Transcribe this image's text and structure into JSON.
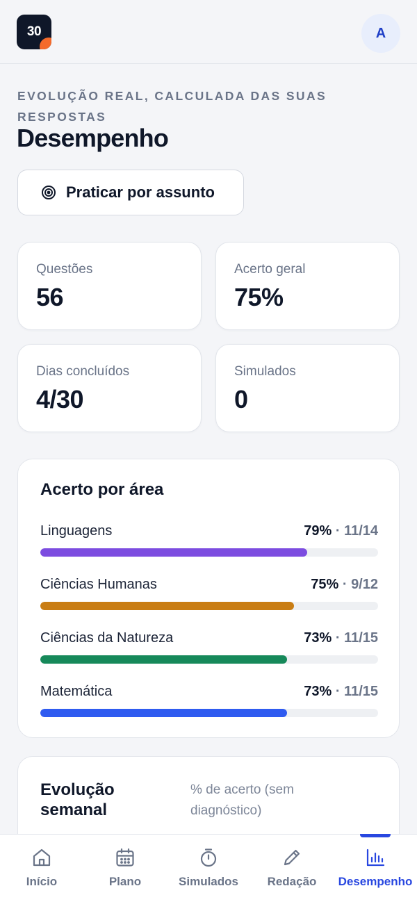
{
  "header": {
    "logo_text": "30",
    "avatar_initial": "A"
  },
  "page": {
    "eyebrow": "Evolução real, calculada das suas respostas",
    "title": "Desempenho",
    "practice_button": {
      "label": "Praticar por assunto",
      "icon": "target-icon"
    }
  },
  "stats": [
    {
      "label": "Questões",
      "value": "56"
    },
    {
      "label": "Acerto geral",
      "value": "75%"
    },
    {
      "label": "Dias concluídos",
      "value": "4/30"
    },
    {
      "label": "Simulados",
      "value": "0"
    }
  ],
  "areas": {
    "title": "Acerto por área",
    "items": [
      {
        "name": "Linguagens",
        "percent": "79%",
        "fraction": "11/14",
        "progress": 0.79,
        "color": "#7c4ce0"
      },
      {
        "name": "Ciências Humanas",
        "percent": "75%",
        "fraction": "9/12",
        "progress": 0.75,
        "color": "#c97d14"
      },
      {
        "name": "Ciências da Natureza",
        "percent": "73%",
        "fraction": "11/15",
        "progress": 0.73,
        "color": "#16895a"
      },
      {
        "name": "Matemática",
        "percent": "73%",
        "fraction": "11/15",
        "progress": 0.73,
        "color": "#2f5bf0"
      }
    ]
  },
  "weekly": {
    "title": "Evolução semanal",
    "subtitle": "% de acerto (sem diagnóstico)"
  },
  "nav": {
    "active_color": "#2847e0",
    "items": [
      {
        "label": "Início",
        "icon": "home-icon"
      },
      {
        "label": "Plano",
        "icon": "calendar-icon"
      },
      {
        "label": "Simulados",
        "icon": "stopwatch-icon"
      },
      {
        "label": "Redação",
        "icon": "pencil-icon"
      },
      {
        "label": "Desempenho",
        "icon": "bar-chart-icon",
        "active": true
      }
    ]
  }
}
